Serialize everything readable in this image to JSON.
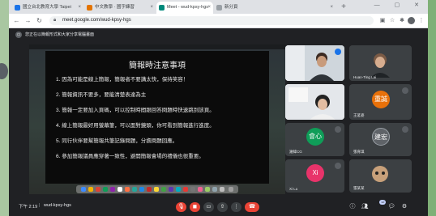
{
  "browser": {
    "tabs": [
      {
        "label": "國立台北教育大學 Taipei",
        "fav_color": "#1a73e8"
      },
      {
        "label": "中文教學 · 國字練習",
        "fav_color": "#e37400"
      },
      {
        "label": "Meet - wud-kpsy-hgs",
        "fav_color": "#00897b"
      },
      {
        "label": "新分頁",
        "fav_color": "#9aa0a6"
      }
    ],
    "url": "meet.google.com/wud-kpsy-hgs",
    "new_tab_symbol": "+",
    "window_controls": "— ▢ ✕"
  },
  "presentation_banner": {
    "text": "您正在以簡報形式和大家分享電腦畫面"
  },
  "slide": {
    "title": "簡報時注意事項",
    "rules": [
      "1. 因為可能是線上簡報，簡報者不要講太快，保持笑容！",
      "2. 簡報資訊不要多，要能清楚表達為主",
      "3. 簡報一定要加入頁碼，可以控制時間跟回答問題時快速跳到該頁。",
      "4. 線上簡報最好用螢幕筆，可以面對鏡頭，你可看到簡報進行進度。",
      "5. 同行伙伴要幫簡報共筆記錄問題，分擔問題回應。",
      "6. 參加簡報議員應穿著一致性，避開簡報會場的禮儀也很重要。"
    ]
  },
  "participants": [
    {
      "name": "",
      "kind": "video",
      "bg": "#d9dee3"
    },
    {
      "name": "Huan-Ting Lai",
      "kind": "video",
      "bg": "#3c4043"
    },
    {
      "name": "",
      "kind": "video",
      "bg": "#e3e6ea"
    },
    {
      "name": "王茗姿",
      "kind": "avatar",
      "initials": "重誠",
      "color": "#e8710a"
    },
    {
      "name": "謝緯CG",
      "kind": "avatar",
      "initials": "會心",
      "color": "#0f9d58"
    },
    {
      "name": "張育琪",
      "kind": "avatar",
      "initials": "建宏",
      "color": "#5f6368"
    },
    {
      "name": "Xi Lu",
      "kind": "avatar",
      "initials": "Xi",
      "color": "#e8336a"
    },
    {
      "name": "張某某",
      "kind": "video",
      "bg": "#3c4043"
    }
  ],
  "bottom_bar": {
    "time": "下午 2:19",
    "separator": "|",
    "meeting_code": "wud-kpsy-hgs",
    "people_count": "12"
  },
  "colors": {
    "meet_dark": "#202124",
    "end_call_red": "#ea4335",
    "control_red": "#ea4335"
  }
}
